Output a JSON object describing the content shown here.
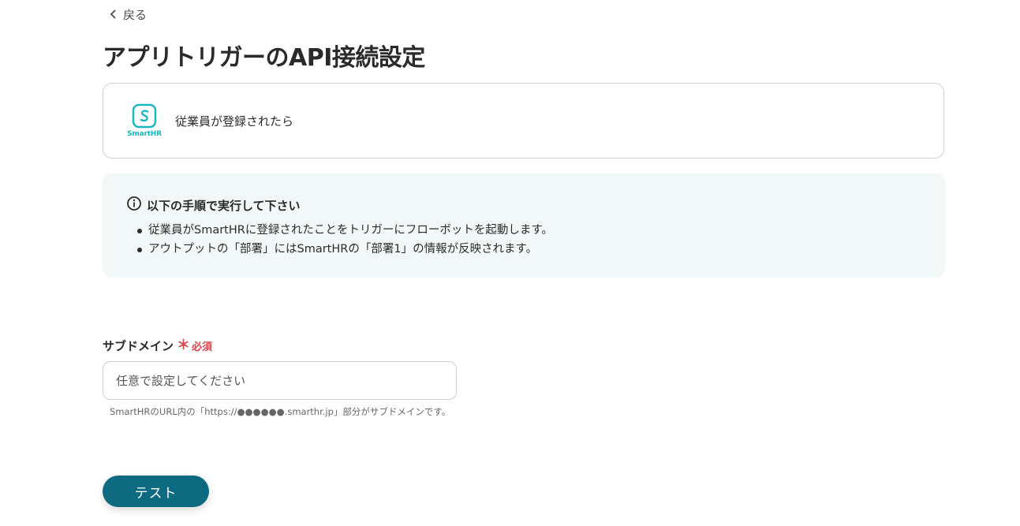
{
  "header": {
    "back_label": "戻る",
    "title": "アプリトリガーのAPI接続設定"
  },
  "app": {
    "logo_text": "SmartHR",
    "logo_icon": "smarthr-logo-icon",
    "brand_color": "#19b8c0",
    "trigger_name": "従業員が登録されたら"
  },
  "instructions": {
    "heading": "以下の手順で実行して下さい",
    "items": [
      "従業員がSmartHRに登録されたことをトリガーにフローボットを起動します。",
      "アウトプットの「部署」にはSmartHRの「部署1」の情報が反映されます。"
    ]
  },
  "form": {
    "subdomain": {
      "label": "サブドメイン",
      "required_mark": "＊",
      "required_label": "必須",
      "placeholder": "任意で設定してください",
      "value": "",
      "help": "SmartHRのURL内の「https://●●●●●●.smarthr.jp」部分がサブドメインです。"
    }
  },
  "actions": {
    "test_label": "テスト",
    "accent_color": "#0e6a80"
  }
}
